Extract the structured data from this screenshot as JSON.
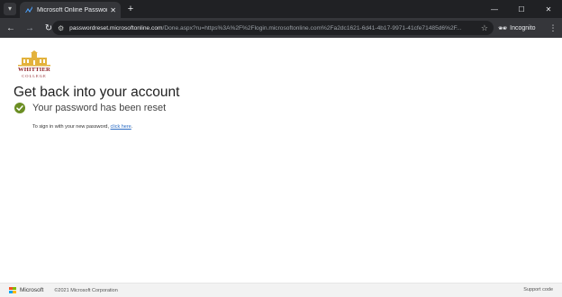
{
  "browser": {
    "tab": {
      "title": "Microsoft Online Password Res",
      "favicon": "microsoft-password-icon"
    },
    "url": {
      "host": "passwordreset.microsoftonline.com",
      "rest": "/Done.aspx?ru=https%3A%2F%2Flogin.microsoftonline.com%2Fa2dc1621-6d41-4b17-9971-41cfe71485d6%2F..."
    },
    "profile_label": "Incognito"
  },
  "logo": {
    "name": "WHITTIER",
    "sub": "COLLEGE"
  },
  "main": {
    "title": "Get back into your account",
    "status": "Your password has been reset",
    "signin_prefix": "To sign in with your new password, ",
    "signin_link": "click here",
    "signin_suffix": "."
  },
  "footer": {
    "brand": "Microsoft",
    "copyright": "©2021 Microsoft Corporation",
    "support": "Support code"
  },
  "colors": {
    "accent_check": "#6b8e23",
    "link": "#2b6cc4",
    "college": "#8a1c22"
  }
}
